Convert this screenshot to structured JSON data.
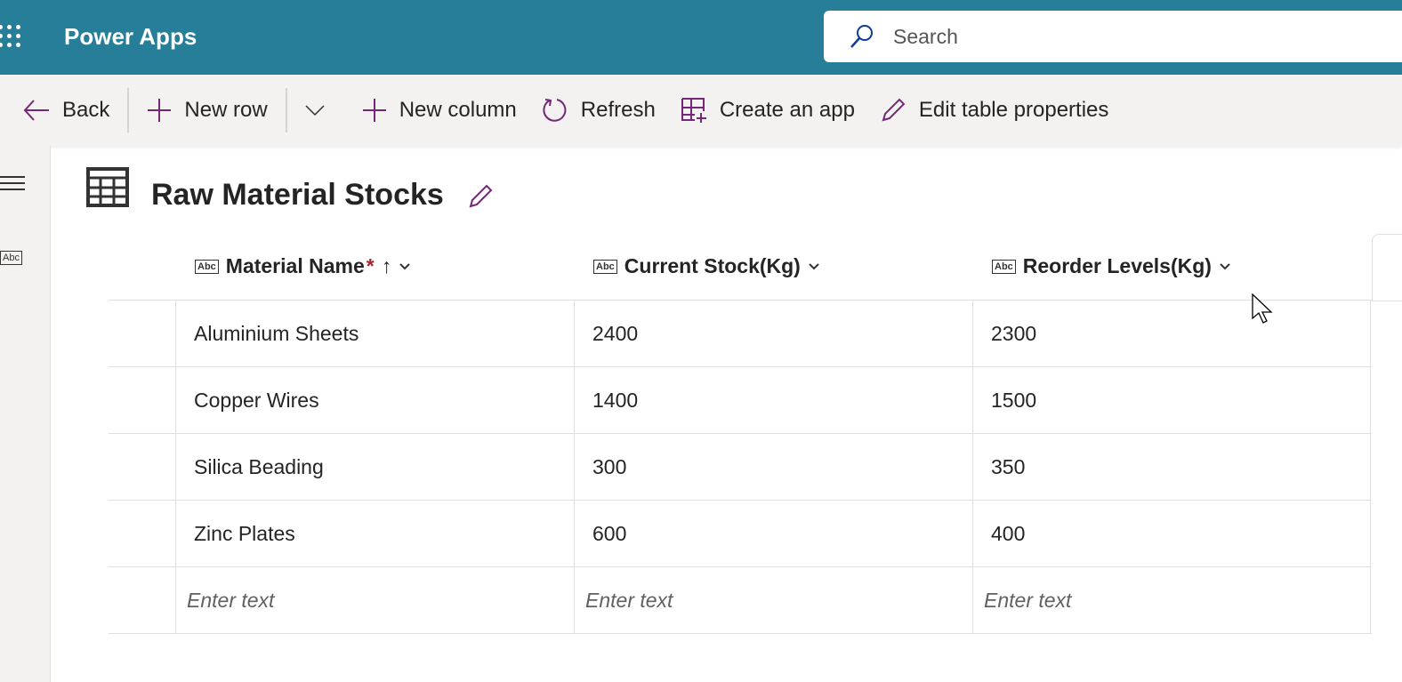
{
  "app": {
    "title": "Power Apps",
    "search_placeholder": "Search"
  },
  "toolbar": {
    "back": "Back",
    "new_row": "New row",
    "new_column": "New column",
    "refresh": "Refresh",
    "create_app": "Create an app",
    "edit_props": "Edit table properties"
  },
  "page": {
    "title": "Raw Material Stocks",
    "abc": "Abc"
  },
  "table": {
    "columns": [
      {
        "label": "Material Name",
        "required": "*"
      },
      {
        "label": "Current Stock(Kg)"
      },
      {
        "label": "Reorder Levels(Kg)"
      }
    ],
    "rows": [
      [
        "Aluminium Sheets",
        "2400",
        "2300"
      ],
      [
        "Copper Wires",
        "1400",
        "1500"
      ],
      [
        "Silica Beading",
        "300",
        "350"
      ],
      [
        "Zinc Plates",
        "600",
        "400"
      ]
    ],
    "placeholder": "Enter text"
  },
  "colors": {
    "header": "#277e98",
    "accent": "#742774"
  }
}
